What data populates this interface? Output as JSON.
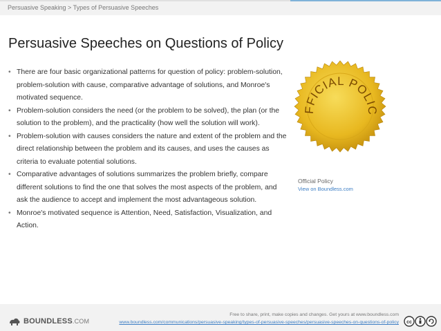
{
  "breadcrumb": "Persuasive Speaking > Types of Persuasive Speeches",
  "title": "Persuasive Speeches on Questions of Policy",
  "bullets": [
    "There are four basic organizational patterns for question of policy: problem-solution, problem-solution with cause, comparative advantage of solutions, and Monroe's motivated sequence.",
    "Problem-solution considers the need (or the problem to be solved), the plan (or the solution to the problem), and the practicality (how well the solution will work).",
    "Problem-solution with causes considers the nature and extent of the problem and the direct relationship between the problem and its causes, and uses the causes as criteria to evaluate potential solutions.",
    "Comparative advantages of solutions summarizes the problem briefly, compare different solutions to find the one that solves the most aspects of the problem, and ask the audience to accept and implement the most advantageous solution.",
    "Monroe's motivated sequence is Attention, Need, Satisfaction, Visualization, and Action."
  ],
  "figure": {
    "seal_text": "OFFICIAL POLICY",
    "caption": "Official Policy",
    "link": "View on Boundless.com"
  },
  "footer": {
    "logo_text": "BOUNDLESS",
    "logo_suffix": ".COM",
    "line1": "Free to share, print, make copies and changes. Get yours at www.boundless.com",
    "line2": "www.boundless.com/communications/persuasive-speaking/types-of-persuasive-speeches/persuasive-speeches-on-questions-of-policy"
  },
  "colors": {
    "seal_gold": "#e8b820",
    "seal_text": "#7a4a00",
    "link_blue": "#3b7dc4",
    "accent_blue": "#7fb2d8"
  }
}
